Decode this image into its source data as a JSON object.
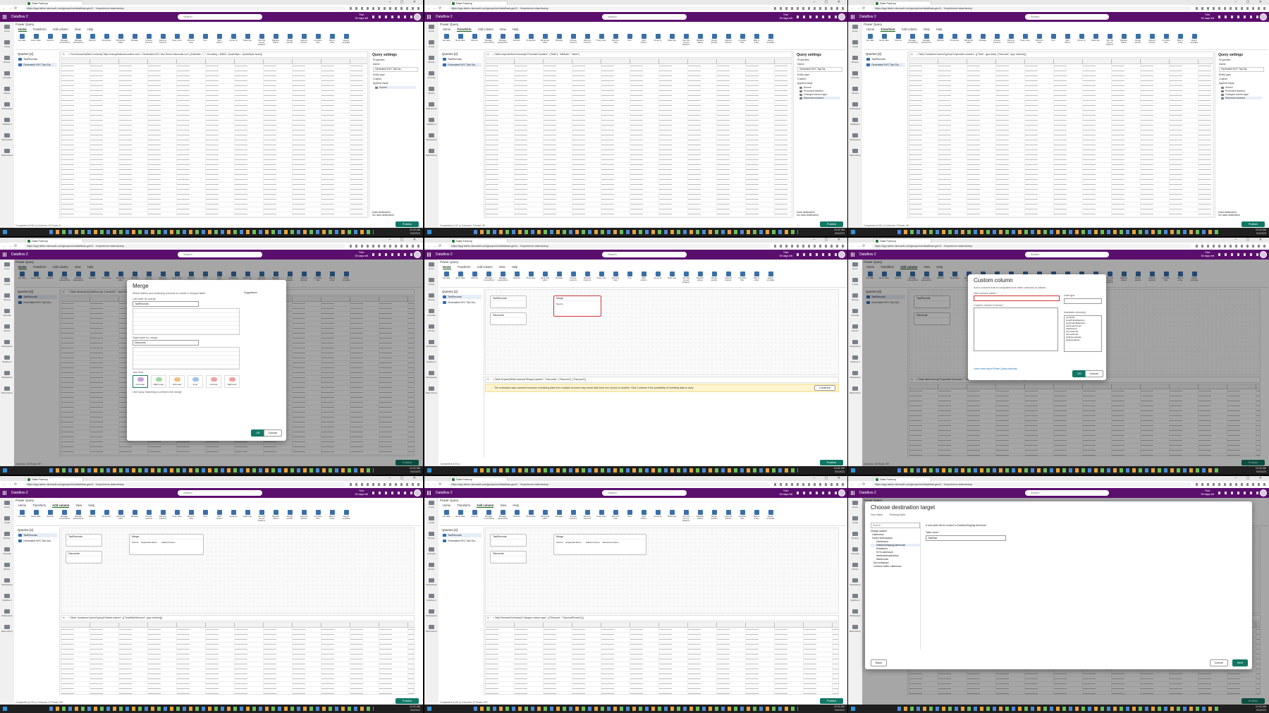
{
  "browser": {
    "tab_title": "Data Factory",
    "url": "https://app.fabric.microsoft.com/groups/me/dataflows-gen2/...?experience=data-factory"
  },
  "app": {
    "item_name": "Dataflow 2",
    "search_placeholder": "Search",
    "trial_line1": "Trial:",
    "trial_line2": "59 days left",
    "pq_title": "Power Query",
    "publish_label": "Publish"
  },
  "rail_labels": [
    "Home",
    "Create",
    "Browse",
    "OneLake",
    "Monitor",
    "Workspaces",
    "Dataflow 2",
    "Workspaces",
    "Data Factory"
  ],
  "menus": [
    "Home",
    "Transform",
    "Add column",
    "View",
    "Help"
  ],
  "ribbon_labels": [
    "Get data",
    "Enter data",
    "Options",
    "Manage connections",
    "Manage parameters",
    "Refresh",
    "Properties",
    "Advanced editor",
    "Manage",
    "Choose columns",
    "Remove columns",
    "Keep rows",
    "Remove rows",
    "Sort",
    "Split column",
    "Group by",
    "Data type",
    "Use first row as headers",
    "Replace values",
    "Merge queries",
    "Append queries",
    "Combine files",
    "Map to entity",
    "Export template"
  ],
  "queries": {
    "header": "Queries [2]",
    "items": [
      "TaxiRecords",
      "Generated NYC Taxi Da..."
    ]
  },
  "query_settings": {
    "title": "Query settings",
    "properties": "Properties",
    "name_label": "Name",
    "name_value": "Generated NYC Taxi Da...",
    "entity_type_label": "Entity type",
    "entity_type_value": "Custom",
    "applied_steps": "Applied steps",
    "steps": [
      "Source",
      "Promoted headers",
      "Changed column type",
      "Removed columns"
    ],
    "data_destination": "Data destination",
    "no_destination": "No data destination"
  },
  "formulas": [
    "= Csv.Document(Web.Contents(\"https://raw.githubusercontent.com/.../Generated-NYC-Taxi-Green-Discounts.csv\"), [Delimiter = \",\", Encoding = 65001, QuoteStyle = QuoteStyle.None])",
    "= Table.UnpivotOtherColumns(#\"Promoted headers\", {\"Date\"}, \"Attribute\", \"Value\")",
    "= Table.TransformColumnTypes(#\"Unpivoted columns\", {{\"Date\", type date}, {\"Discount\", type number}})",
    "= Table.NestedJoin(TaxiRecords, {\"vendorID\", \"lpepPickupDatetime\"}, Discounts, {\"Vendor\", \"Date\"}, \"Discounts\", JoinKind.LeftOuter)",
    "= Table.ExpandTableColumn(#\"Merged queries\", \"Discounts\", {\"Discount\"}, {\"Discount\"})",
    "= Table.AddColumn(#\"Expanded Discounts\", \"TotalAfterDiscount\", each [totalAmount] * (1 - [Discount]))",
    "= Table.TransformColumnTypes(#\"Added custom\", {{\"TotalAfterDiscount\", type number}})",
    "= Table.RenameColumns(#\"Changed column type\", {{\"Discount\", \"DiscountPercent\"}})"
  ],
  "status_texts": [
    "Completed (0.55 s)   Columns: 32   Rows: 5",
    "Completed (1.01 s)   Columns: 3   Rows: 3K",
    "Completed (0.82 s)   Columns: 3   Rows: 3K",
    "Columns: 34   Rows: 99+",
    "Completed (0.5 s)",
    "Columns: 36   Rows: 99+",
    "Completed (4.29 s)   Columns: 37   Rows: 99+",
    "Completed (2.84 s)   Columns: 37   Rows: 99+",
    ""
  ],
  "merge_dialog": {
    "title": "Merge",
    "subtitle": "Select tables and matching columns to create a merged table.",
    "left_label": "Left table for merge",
    "left_value": "TaxiRecords",
    "right_label": "Right table for merge",
    "right_value": "Discounts",
    "suggestions": "Suggestions",
    "join_kind": "Join kind",
    "join_options": [
      "Left outer",
      "Right outer",
      "Full outer",
      "Inner",
      "Left anti",
      "Right anti"
    ],
    "fuzzy": "Use fuzzy matching to perform the merge",
    "ok": "OK",
    "cancel": "Cancel"
  },
  "warning_text": "The evaluation was canceled because combining data from multiple sources may reveal data from one source to another. Click Continue if the possibility of revealing data is okay.",
  "warning_btn": "Continue",
  "custom_column": {
    "title": "Custom column",
    "subtitle": "Add a column that is computed from other columns or values.",
    "name_label": "New column name *",
    "type_label": "Data type",
    "formula_label": "Custom column formula *",
    "available": "Available column(s)",
    "columns": [
      "vendorID",
      "lpepPickupDatetime",
      "lpepDropoffDatetime",
      "passengerCount",
      "tripDistance",
      "puLocationId",
      "doLocationId",
      "pickupLongitude",
      "pickupLatitude"
    ],
    "learn": "Learn more about Power Query formulas",
    "ok": "OK",
    "cancel": "Cancel"
  },
  "destination": {
    "title": "Choose destination target",
    "new_table": "New table",
    "existing": "Existing table",
    "search": "Search",
    "display": "Display options",
    "tree": [
      "Lakehouse",
      "Fabric Workspaces",
      "Dashboard",
      "DataflowStagingLakehouse",
      "Retailstore",
      "NYCLakehouse",
      "NorthwindLakehouse",
      "Warehouse",
      "My workspace",
      "Contoso Sales Lakehouse"
    ],
    "info": "A new table will be created in DataflowStagingLakehouse.",
    "table_name_label": "Table name *",
    "table_name_value": "TaxiData",
    "back": "Back",
    "cancel": "Cancel",
    "next": "Next"
  },
  "diagram": {
    "taxi": "TaxiRecords",
    "discounts": "Discounts",
    "merge": "Merge",
    "steps": [
      "Source",
      "Expanded Disco...",
      "Added Custom",
      "Renamed Colum..."
    ]
  },
  "clock": {
    "time": "10:42 AM",
    "date": "9/4/2023"
  }
}
